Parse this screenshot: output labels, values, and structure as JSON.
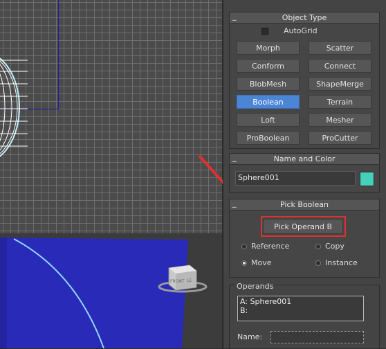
{
  "colors": {
    "viewport_grid_bg": "#4b4b4b",
    "active_button": "#4b86d6",
    "swatch": "#44d1b8",
    "annotation_red": "#e03030",
    "perspective_floor": "#2a2ab8"
  },
  "viewports": {
    "top_icon": "wireframe-sphere",
    "persp_icon": "viewcube",
    "viewcube_labels": [
      "FRONT",
      "LE"
    ]
  },
  "object_type": {
    "title": "Object Type",
    "autogrid_label": "AutoGrid",
    "autogrid_checked": false,
    "buttons": [
      "Morph",
      "Scatter",
      "Conform",
      "Connect",
      "BlobMesh",
      "ShapeMerge",
      "Boolean",
      "Terrain",
      "Loft",
      "Mesher",
      "ProBoolean",
      "ProCutter"
    ],
    "active_button": "Boolean"
  },
  "name_color": {
    "title": "Name and Color",
    "name_value": "Sphere001"
  },
  "pick_boolean": {
    "title": "Pick Boolean",
    "pick_button": "Pick Operand B",
    "radios": [
      "Reference",
      "Copy",
      "Move",
      "Instance"
    ],
    "selected": "Move"
  },
  "operands": {
    "title": "Operands",
    "items": [
      "A: Sphere001",
      "B:"
    ],
    "name_label": "Name:"
  },
  "rollout_toggle": "_"
}
